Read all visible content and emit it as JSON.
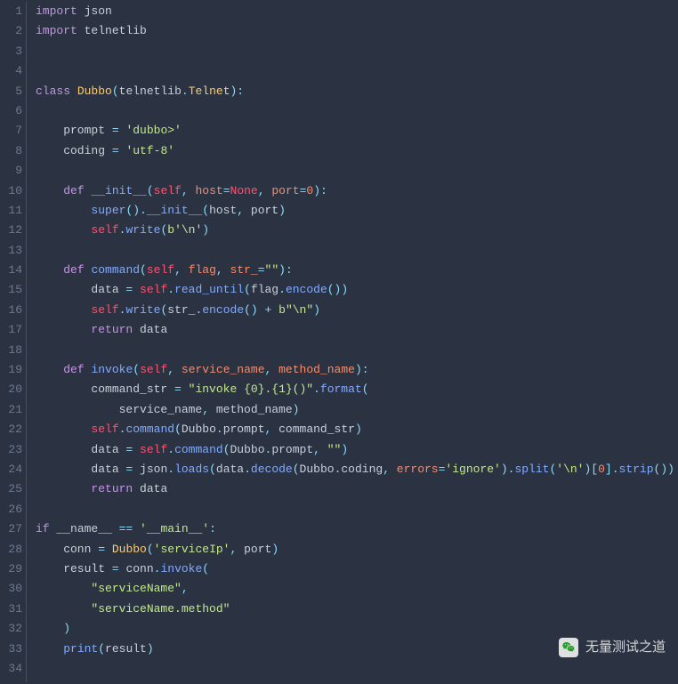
{
  "watermark": {
    "text": "无量测试之道"
  },
  "lines": [
    {
      "n": 1,
      "tokens": [
        [
          "kw",
          "import"
        ],
        [
          "id",
          " json"
        ]
      ]
    },
    {
      "n": 2,
      "tokens": [
        [
          "kw",
          "import"
        ],
        [
          "id",
          " telnetlib"
        ]
      ]
    },
    {
      "n": 3,
      "tokens": []
    },
    {
      "n": 4,
      "tokens": []
    },
    {
      "n": 5,
      "tokens": [
        [
          "kw",
          "class"
        ],
        [
          "id",
          " "
        ],
        [
          "cls",
          "Dubbo"
        ],
        [
          "op",
          "("
        ],
        [
          "id",
          "telnetlib"
        ],
        [
          "op",
          "."
        ],
        [
          "cls",
          "Telnet"
        ],
        [
          "op",
          "):"
        ]
      ]
    },
    {
      "n": 6,
      "tokens": []
    },
    {
      "n": 7,
      "tokens": [
        [
          "id",
          "    prompt "
        ],
        [
          "op",
          "="
        ],
        [
          "id",
          " "
        ],
        [
          "str",
          "'dubbo>'"
        ]
      ]
    },
    {
      "n": 8,
      "tokens": [
        [
          "id",
          "    coding "
        ],
        [
          "op",
          "="
        ],
        [
          "id",
          " "
        ],
        [
          "str",
          "'utf-8'"
        ]
      ]
    },
    {
      "n": 9,
      "tokens": []
    },
    {
      "n": 10,
      "tokens": [
        [
          "id",
          "    "
        ],
        [
          "kw",
          "def"
        ],
        [
          "id",
          " "
        ],
        [
          "fn",
          "__init__"
        ],
        [
          "op",
          "("
        ],
        [
          "slf",
          "self"
        ],
        [
          "op",
          ", "
        ],
        [
          "arg",
          "host"
        ],
        [
          "op",
          "="
        ],
        [
          "slf",
          "None"
        ],
        [
          "op",
          ", "
        ],
        [
          "arg",
          "port"
        ],
        [
          "op",
          "="
        ],
        [
          "num",
          "0"
        ],
        [
          "op",
          "):"
        ]
      ]
    },
    {
      "n": 11,
      "tokens": [
        [
          "id",
          "        "
        ],
        [
          "builtin",
          "super"
        ],
        [
          "op",
          "()."
        ],
        [
          "fn",
          "__init__"
        ],
        [
          "op",
          "("
        ],
        [
          "id",
          "host"
        ],
        [
          "op",
          ", "
        ],
        [
          "id",
          "port"
        ],
        [
          "op",
          ")"
        ]
      ]
    },
    {
      "n": 12,
      "tokens": [
        [
          "id",
          "        "
        ],
        [
          "slf",
          "self"
        ],
        [
          "op",
          "."
        ],
        [
          "fn",
          "write"
        ],
        [
          "op",
          "("
        ],
        [
          "str",
          "b'\\n'"
        ],
        [
          "op",
          ")"
        ]
      ]
    },
    {
      "n": 13,
      "tokens": []
    },
    {
      "n": 14,
      "tokens": [
        [
          "id",
          "    "
        ],
        [
          "kw",
          "def"
        ],
        [
          "id",
          " "
        ],
        [
          "fn",
          "command"
        ],
        [
          "op",
          "("
        ],
        [
          "slf",
          "self"
        ],
        [
          "op",
          ", "
        ],
        [
          "arg",
          "flag"
        ],
        [
          "op",
          ", "
        ],
        [
          "arg",
          "str_"
        ],
        [
          "op",
          "="
        ],
        [
          "str",
          "\"\""
        ],
        [
          "op",
          "):"
        ]
      ]
    },
    {
      "n": 15,
      "tokens": [
        [
          "id",
          "        data "
        ],
        [
          "op",
          "="
        ],
        [
          "id",
          " "
        ],
        [
          "slf",
          "self"
        ],
        [
          "op",
          "."
        ],
        [
          "fn",
          "read_until"
        ],
        [
          "op",
          "("
        ],
        [
          "id",
          "flag"
        ],
        [
          "op",
          "."
        ],
        [
          "fn",
          "encode"
        ],
        [
          "op",
          "())"
        ]
      ]
    },
    {
      "n": 16,
      "tokens": [
        [
          "id",
          "        "
        ],
        [
          "slf",
          "self"
        ],
        [
          "op",
          "."
        ],
        [
          "fn",
          "write"
        ],
        [
          "op",
          "("
        ],
        [
          "id",
          "str_"
        ],
        [
          "op",
          "."
        ],
        [
          "fn",
          "encode"
        ],
        [
          "op",
          "() "
        ],
        [
          "op",
          "+"
        ],
        [
          "id",
          " "
        ],
        [
          "str",
          "b\"\\n\""
        ],
        [
          "op",
          ")"
        ]
      ]
    },
    {
      "n": 17,
      "tokens": [
        [
          "id",
          "        "
        ],
        [
          "kw",
          "return"
        ],
        [
          "id",
          " data"
        ]
      ]
    },
    {
      "n": 18,
      "tokens": []
    },
    {
      "n": 19,
      "tokens": [
        [
          "id",
          "    "
        ],
        [
          "kw",
          "def"
        ],
        [
          "id",
          " "
        ],
        [
          "fn",
          "invoke"
        ],
        [
          "op",
          "("
        ],
        [
          "slf",
          "self"
        ],
        [
          "op",
          ", "
        ],
        [
          "arg",
          "service_name"
        ],
        [
          "op",
          ", "
        ],
        [
          "arg",
          "method_name"
        ],
        [
          "op",
          "):"
        ]
      ]
    },
    {
      "n": 20,
      "tokens": [
        [
          "id",
          "        command_str "
        ],
        [
          "op",
          "="
        ],
        [
          "id",
          " "
        ],
        [
          "str",
          "\"invoke {0}.{1}()\""
        ],
        [
          "op",
          "."
        ],
        [
          "fn",
          "format"
        ],
        [
          "op",
          "("
        ]
      ]
    },
    {
      "n": 21,
      "tokens": [
        [
          "id",
          "            service_name"
        ],
        [
          "op",
          ", "
        ],
        [
          "id",
          "method_name"
        ],
        [
          "op",
          ")"
        ]
      ]
    },
    {
      "n": 22,
      "tokens": [
        [
          "id",
          "        "
        ],
        [
          "slf",
          "self"
        ],
        [
          "op",
          "."
        ],
        [
          "fn",
          "command"
        ],
        [
          "op",
          "("
        ],
        [
          "id",
          "Dubbo"
        ],
        [
          "op",
          "."
        ],
        [
          "id",
          "prompt"
        ],
        [
          "op",
          ", "
        ],
        [
          "id",
          "command_str"
        ],
        [
          "op",
          ")"
        ]
      ]
    },
    {
      "n": 23,
      "tokens": [
        [
          "id",
          "        data "
        ],
        [
          "op",
          "="
        ],
        [
          "id",
          " "
        ],
        [
          "slf",
          "self"
        ],
        [
          "op",
          "."
        ],
        [
          "fn",
          "command"
        ],
        [
          "op",
          "("
        ],
        [
          "id",
          "Dubbo"
        ],
        [
          "op",
          "."
        ],
        [
          "id",
          "prompt"
        ],
        [
          "op",
          ", "
        ],
        [
          "str",
          "\"\""
        ],
        [
          "op",
          ")"
        ]
      ]
    },
    {
      "n": 24,
      "tokens": [
        [
          "id",
          "        data "
        ],
        [
          "op",
          "="
        ],
        [
          "id",
          " json"
        ],
        [
          "op",
          "."
        ],
        [
          "fn",
          "loads"
        ],
        [
          "op",
          "("
        ],
        [
          "id",
          "data"
        ],
        [
          "op",
          "."
        ],
        [
          "fn",
          "decode"
        ],
        [
          "op",
          "("
        ],
        [
          "id",
          "Dubbo"
        ],
        [
          "op",
          "."
        ],
        [
          "id",
          "coding"
        ],
        [
          "op",
          ", "
        ],
        [
          "arg",
          "errors"
        ],
        [
          "op",
          "="
        ],
        [
          "str",
          "'ignore'"
        ],
        [
          "op",
          ")."
        ],
        [
          "fn",
          "split"
        ],
        [
          "op",
          "("
        ],
        [
          "str",
          "'\\n'"
        ],
        [
          "op",
          ")["
        ],
        [
          "num",
          "0"
        ],
        [
          "op",
          "]."
        ],
        [
          "fn",
          "strip"
        ],
        [
          "op",
          "())"
        ]
      ]
    },
    {
      "n": 25,
      "tokens": [
        [
          "id",
          "        "
        ],
        [
          "kw",
          "return"
        ],
        [
          "id",
          " data"
        ]
      ]
    },
    {
      "n": 26,
      "tokens": []
    },
    {
      "n": 27,
      "tokens": [
        [
          "kw",
          "if"
        ],
        [
          "id",
          " __name__ "
        ],
        [
          "op",
          "=="
        ],
        [
          "id",
          " "
        ],
        [
          "str",
          "'__main__'"
        ],
        [
          "op",
          ":"
        ]
      ]
    },
    {
      "n": 28,
      "tokens": [
        [
          "id",
          "    conn "
        ],
        [
          "op",
          "="
        ],
        [
          "id",
          " "
        ],
        [
          "cls",
          "Dubbo"
        ],
        [
          "op",
          "("
        ],
        [
          "str",
          "'serviceIp'"
        ],
        [
          "op",
          ", "
        ],
        [
          "id",
          "port"
        ],
        [
          "op",
          ")"
        ]
      ]
    },
    {
      "n": 29,
      "tokens": [
        [
          "id",
          "    result "
        ],
        [
          "op",
          "="
        ],
        [
          "id",
          " conn"
        ],
        [
          "op",
          "."
        ],
        [
          "fn",
          "invoke"
        ],
        [
          "op",
          "("
        ]
      ]
    },
    {
      "n": 30,
      "tokens": [
        [
          "id",
          "        "
        ],
        [
          "str",
          "\"serviceName\""
        ],
        [
          "op",
          ","
        ]
      ]
    },
    {
      "n": 31,
      "tokens": [
        [
          "id",
          "        "
        ],
        [
          "str",
          "\"serviceName.method\""
        ]
      ]
    },
    {
      "n": 32,
      "tokens": [
        [
          "id",
          "    "
        ],
        [
          "op",
          ")"
        ]
      ]
    },
    {
      "n": 33,
      "tokens": [
        [
          "id",
          "    "
        ],
        [
          "builtin",
          "print"
        ],
        [
          "op",
          "("
        ],
        [
          "id",
          "result"
        ],
        [
          "op",
          ")"
        ]
      ]
    },
    {
      "n": 34,
      "tokens": []
    }
  ]
}
